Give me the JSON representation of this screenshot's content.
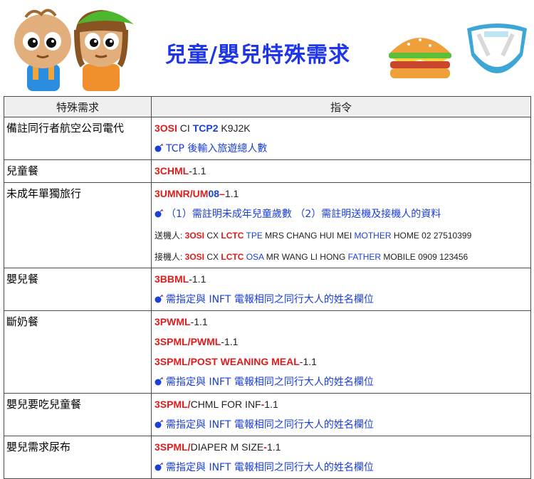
{
  "title": "兒童/嬰兒特殊需求",
  "table": {
    "headers": [
      "特殊需求",
      "指令"
    ],
    "rows": [
      {
        "name": "備註同行者航空公司電代",
        "lines": [
          {
            "type": "cmd",
            "parts": [
              [
                "red",
                "3OSI"
              ],
              [
                "plain",
                " CI "
              ],
              [
                "blue",
                "TCP2"
              ],
              [
                "plain",
                " K9J2K"
              ]
            ]
          },
          {
            "type": "note",
            "text": "TCP 後輸入旅遊總人數"
          }
        ]
      },
      {
        "name": "兒童餐",
        "lines": [
          {
            "type": "cmd",
            "parts": [
              [
                "red",
                "3CHML"
              ],
              [
                "plain",
                "-1.1"
              ]
            ]
          }
        ]
      },
      {
        "name": "未成年單獨旅行",
        "lines": [
          {
            "type": "cmd",
            "parts": [
              [
                "red",
                "3UMNR/UM"
              ],
              [
                "blue",
                "08"
              ],
              [
                "red",
                "–"
              ],
              [
                "plain",
                "1.1"
              ]
            ]
          },
          {
            "type": "note",
            "text": "（1）需註明未成年兒童歲數 （2）需註明送機及接機人的資料"
          },
          {
            "type": "small",
            "parts": [
              [
                "plain",
                "送機人: "
              ],
              [
                "red",
                "3OSI"
              ],
              [
                "plain",
                " CX "
              ],
              [
                "red",
                "LCTC"
              ],
              [
                "bluen",
                " TPE"
              ],
              [
                "plain",
                " MRS CHANG HUI MEI "
              ],
              [
                "bluen",
                "MOTHER"
              ],
              [
                "plain",
                " HOME 02 27510399"
              ]
            ]
          },
          {
            "type": "small",
            "parts": [
              [
                "plain",
                "接機人: "
              ],
              [
                "red",
                "3OSI"
              ],
              [
                "plain",
                " CX "
              ],
              [
                "red",
                "LCTC"
              ],
              [
                "bluen",
                " OSA"
              ],
              [
                "plain",
                " MR WANG LI HONG "
              ],
              [
                "bluen",
                "FATHER"
              ],
              [
                "plain",
                " MOBILE 0909 123456"
              ]
            ]
          }
        ]
      },
      {
        "name": "嬰兒餐",
        "lines": [
          {
            "type": "cmd",
            "parts": [
              [
                "red",
                "3BBML"
              ],
              [
                "plain",
                "-1.1"
              ]
            ]
          },
          {
            "type": "note",
            "text": "需指定與 INFT 電報相同之同行大人的姓名欄位"
          }
        ]
      },
      {
        "name": "斷奶餐",
        "lines": [
          {
            "type": "cmd",
            "parts": [
              [
                "red",
                "3PWML"
              ],
              [
                "plain",
                "-1.1"
              ]
            ]
          },
          {
            "type": "cmd",
            "parts": [
              [
                "red",
                "3SPML/PWML"
              ],
              [
                "plain",
                "-1.1"
              ]
            ]
          },
          {
            "type": "cmd",
            "parts": [
              [
                "red",
                "3SPML/POST WEANING MEAL"
              ],
              [
                "plain",
                "-1.1"
              ]
            ]
          },
          {
            "type": "note",
            "text": "需指定與 INFT 電報相同之同行大人的姓名欄位"
          }
        ]
      },
      {
        "name": "嬰兒要吃兒童餐",
        "lines": [
          {
            "type": "cmd",
            "parts": [
              [
                "red",
                "3SPML/"
              ],
              [
                "plain",
                "CHML FOR INF"
              ],
              [
                "red",
                "-"
              ],
              [
                "plain",
                "1.1"
              ]
            ]
          },
          {
            "type": "note",
            "text": "需指定與 INFT 電報相同之同行大人的姓名欄位"
          }
        ]
      },
      {
        "name": "嬰兒需求尿布",
        "lines": [
          {
            "type": "cmd",
            "parts": [
              [
                "red",
                "3SPML/"
              ],
              [
                "plain",
                "DIAPER M SIZE"
              ],
              [
                "red",
                "-"
              ],
              [
                "plain",
                "1.1"
              ]
            ]
          },
          {
            "type": "note",
            "text": "需指定與 INFT 電報相同之同行大人的姓名欄位"
          }
        ]
      }
    ]
  }
}
